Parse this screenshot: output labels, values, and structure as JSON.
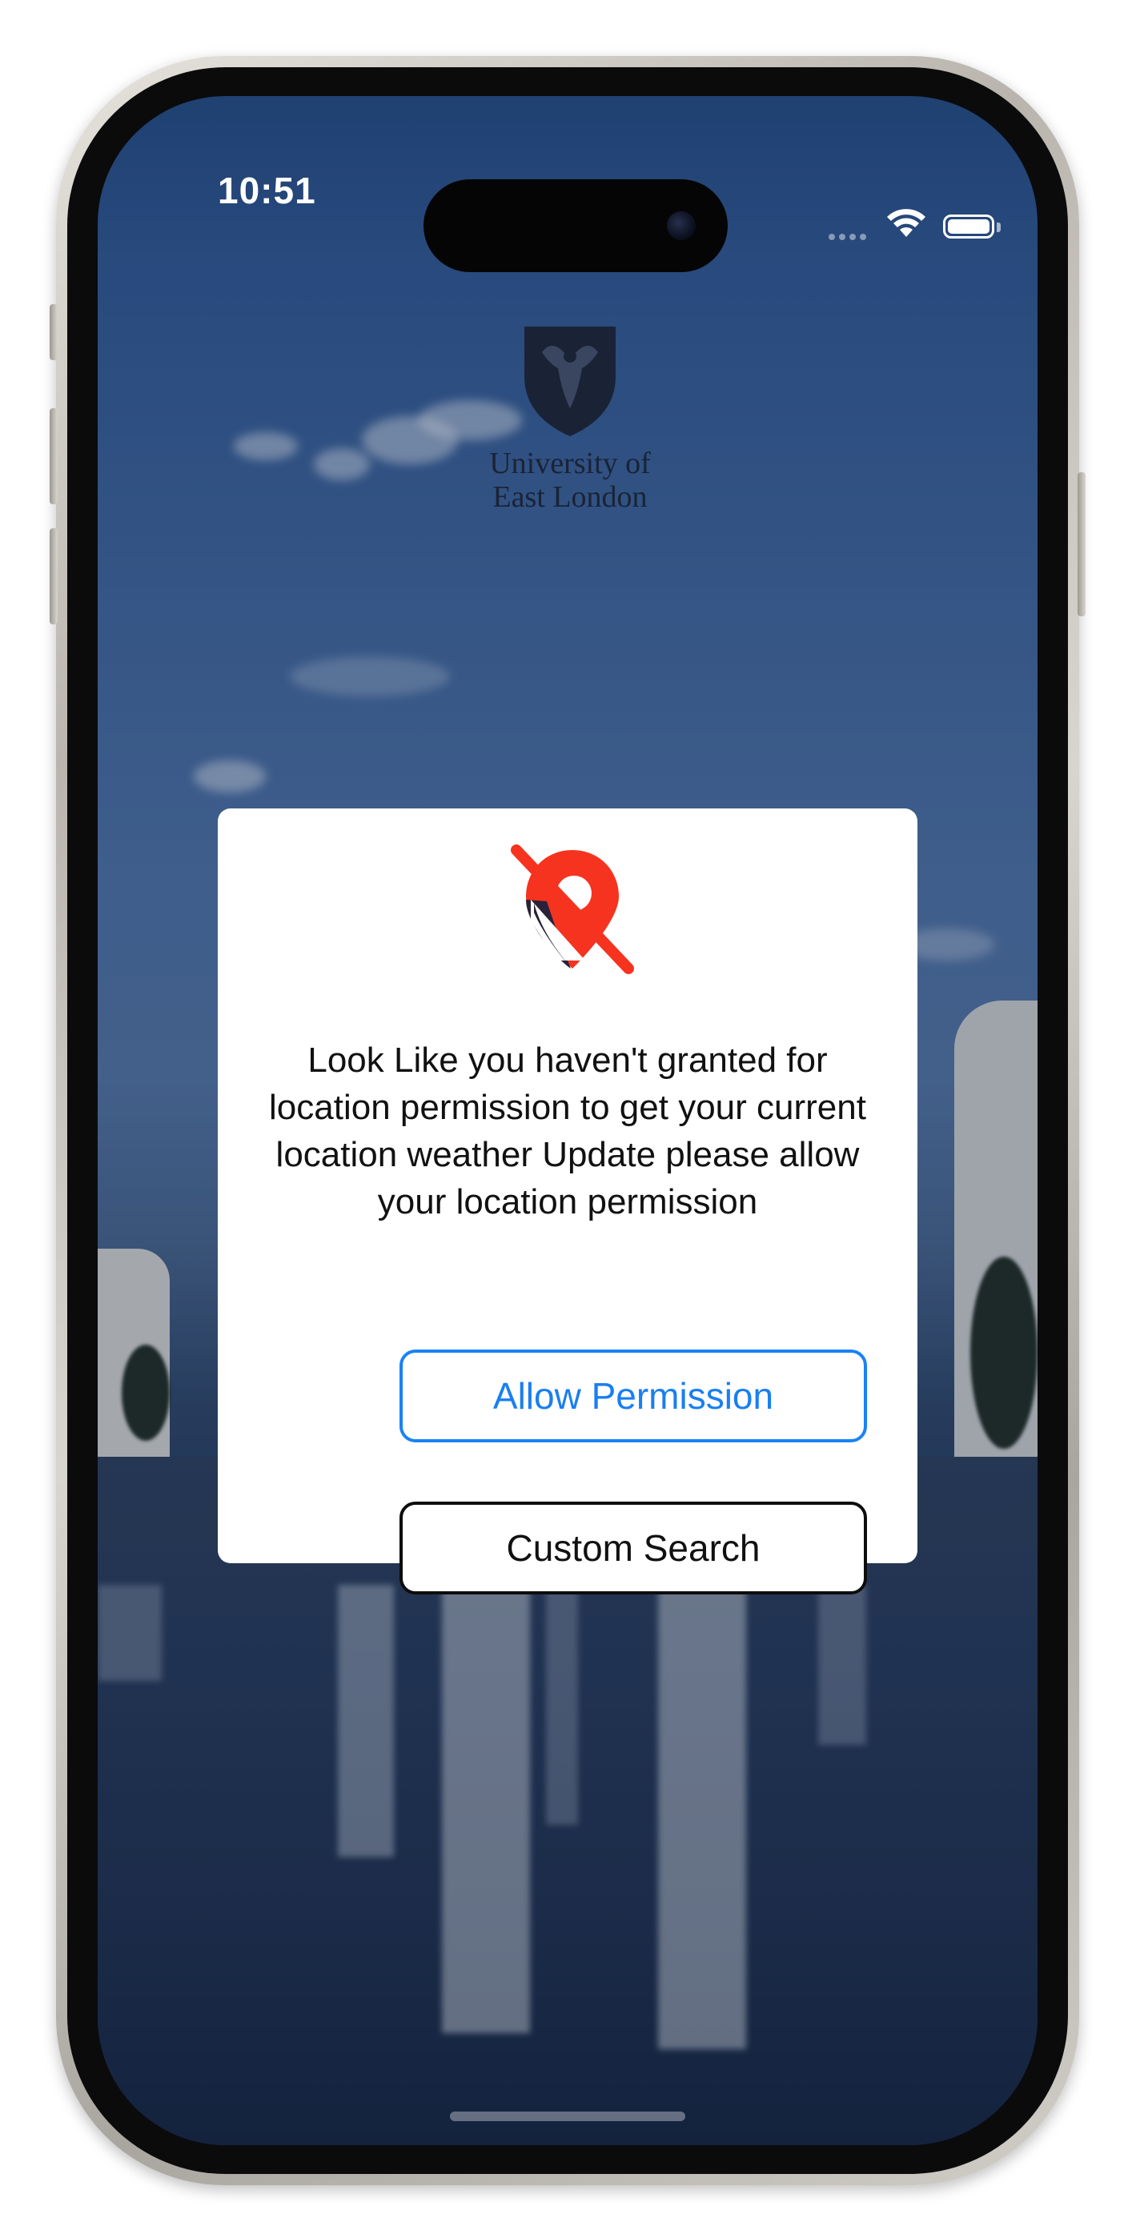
{
  "status_bar": {
    "time": "10:51",
    "battery_level": 1.0,
    "wifi": "wifi-icon"
  },
  "background": {
    "logo_line1": "University of",
    "logo_line2": "East London"
  },
  "dialog": {
    "icon": "location-off-icon",
    "message": "Look Like you haven't granted for location permission to get your current location weather Update please allow your location permission",
    "allow_button_label": "Allow Permission",
    "search_button_label": "Custom Search"
  },
  "colors": {
    "allow_accent": "#1a82f5",
    "icon_red": "#f6331f",
    "icon_dark": "#2a2238"
  }
}
